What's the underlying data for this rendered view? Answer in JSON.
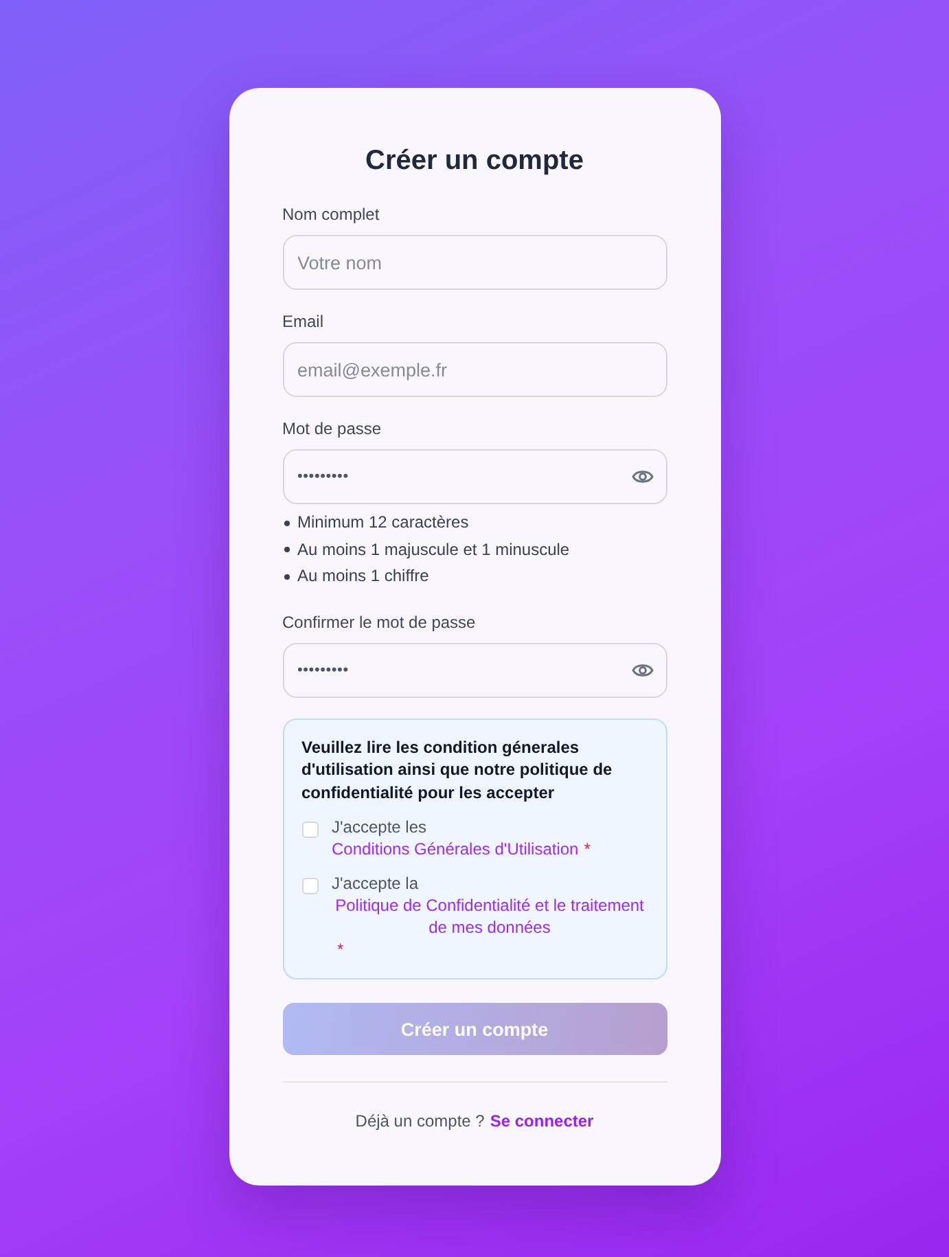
{
  "title": "Créer un compte",
  "fields": [
    {
      "kind": "text",
      "label": "Nom complet",
      "placeholder": "Votre nom"
    },
    {
      "kind": "email",
      "label": "Email",
      "placeholder": "email@exemple.fr"
    },
    {
      "kind": "password",
      "label": "Mot de passe",
      "value": "•••••••••",
      "requirements": [
        "Minimum 12 caractères",
        "Au moins 1 majuscule et 1 minuscule",
        "Au moins 1 chiffre"
      ]
    },
    {
      "kind": "password",
      "label": "Confirmer le mot de passe",
      "value": "•••••••••"
    }
  ],
  "terms": {
    "notice": "Veuillez lire les condition génerales d'utilisation ainsi que notre politique de confidentialité pour les accepter",
    "checkboxes": [
      {
        "label": "J'accepte les",
        "link": "Conditions Générales d'Utilisation",
        "required_mark": "*",
        "checked": false
      },
      {
        "label": "J'accepte la",
        "link": "Politique de Confidentialité et le traitement de mes données",
        "required_mark": "*",
        "checked": false
      }
    ]
  },
  "submit_button": {
    "label": "Créer un compte",
    "disabled": true
  },
  "footer": {
    "text": "Déjà un compte ?",
    "link": "Se connecter"
  }
}
